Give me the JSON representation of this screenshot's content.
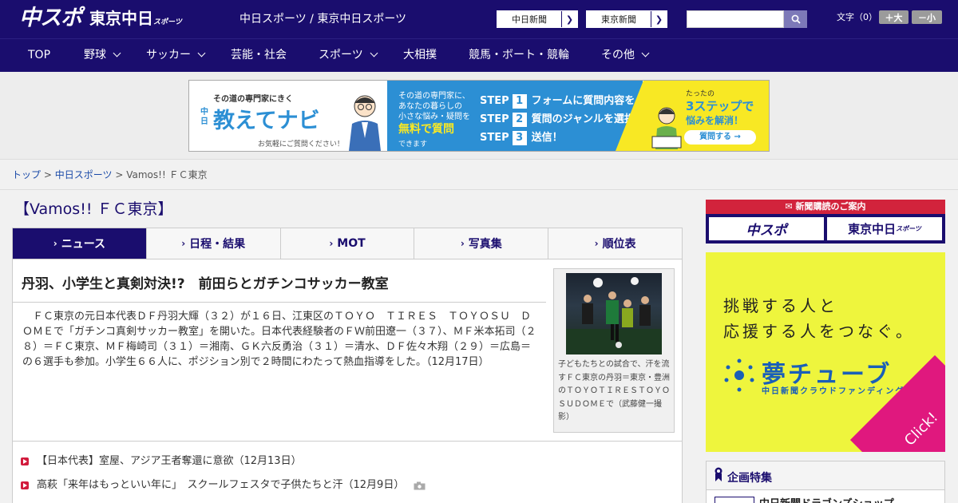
{
  "header": {
    "logo_chuspo": "中スポ",
    "logo_tokyo": "東京中日",
    "logo_tokyo_sub": "スポーツ",
    "tagline": "中日スポーツ / 東京中日スポーツ",
    "link_chunichi": "中日新聞",
    "link_tokyo": "東京新聞",
    "search_placeholder": "",
    "text_size_label": "文字（0）",
    "size_large": "＋大",
    "size_small": "－小"
  },
  "nav": {
    "items": [
      {
        "label": "TOP",
        "has_dropdown": false
      },
      {
        "label": "野球",
        "has_dropdown": true
      },
      {
        "label": "サッカー",
        "has_dropdown": true
      },
      {
        "label": "芸能・社会",
        "has_dropdown": false
      },
      {
        "label": "スポーツ",
        "has_dropdown": true
      },
      {
        "label": "大相撲",
        "has_dropdown": false
      },
      {
        "label": "競馬・ボート・競輪",
        "has_dropdown": false
      },
      {
        "label": "その他",
        "has_dropdown": true
      }
    ]
  },
  "ad_banner": {
    "tagline": "その道の専門家にきく",
    "brand_prefix": "中日",
    "brand": "教えてナビ",
    "note": "お気軽にご質問ください！",
    "intro_1": "その道の専門家に、",
    "intro_2": "あなたの暮らしの",
    "intro_3": "小さな悩み・疑問を",
    "free_label": "無料で質問",
    "free_suffix": "できます",
    "step_word": "STEP",
    "step1": "フォームに質問内容を入力",
    "step2": "質問のジャンルを選択",
    "step3": "送信！",
    "right_1": "たったの",
    "right_2": "3ステップで",
    "right_3": "悩みを解消！",
    "cta": "質問する"
  },
  "breadcrumb": {
    "top": "トップ",
    "section": "中日スポーツ",
    "current": "Vamos!! ＦＣ東京",
    "separator": ">"
  },
  "page_title": "【Vamos!! ＦＣ東京】",
  "tabs": [
    {
      "label": "ニュース",
      "active": true
    },
    {
      "label": "日程・結果",
      "active": false
    },
    {
      "label": "MOT",
      "active": false
    },
    {
      "label": "写真集",
      "active": false
    },
    {
      "label": "順位表",
      "active": false
    }
  ],
  "article": {
    "headline": "丹羽、小学生と真剣対決!?　前田らとガチンコサッカー教室",
    "body": "　ＦＣ東京の元日本代表ＤＦ丹羽大輝（３２）が１６日、江東区のＴＯＹＯ　ＴＩＲＥＳ　ＴＯＹＯＳＵ　ＤＯＭＥで「ガチンコ真剣サッカー教室」を開いた。日本代表経験者のＦＷ前田遼一（３７）、ＭＦ米本拓司（２８）＝ＦＣ東京、ＭＦ梅崎司（３１）＝湘南、ＧＫ六反勇治（３１）＝清水、ＤＦ佐々木翔（２９）＝広島＝の６選手も参加。小学生６６人に、ポジション別で２時間にわたって熱血指導をした。（12月17日）",
    "photo_caption": "子どもたちとの試合で、汗を流すＦＣ東京の丹羽＝東京・豊洲のＴＯＹＯＴＩＲＥＳＴＯＹＯＳＵＤＯＭＥで（武藤健一撮影）"
  },
  "related": [
    {
      "text": "【日本代表】室屋、アジア王者奪還に意欲（12月13日）",
      "has_photo": false
    },
    {
      "text": "高萩「来年はもっといい年に」　スクールフェスタで子供たちと汗（12月9日）",
      "has_photo": true
    }
  ],
  "sidebar": {
    "subscription_header": "新聞購読のご案内",
    "sub_logo1": "中スポ",
    "sub_logo2": "東京中日",
    "sub_logo2_small": "スポーツ",
    "yume_line1": "挑戦する人と",
    "yume_line2": "応援する人をつなぐ。",
    "yume_brand": "夢チューブ",
    "yume_sub": "中日新聞クラウドファンディング",
    "yume_click": "Click!",
    "feature_title": "企画特集",
    "feature_item": "中日新聞ドラゴンズショップ"
  },
  "colors": {
    "brand_navy": "#1a0d6e",
    "accent_red": "#d21b3d",
    "ad_blue": "#2c8fd4",
    "ad_yellow": "#f8e824"
  }
}
